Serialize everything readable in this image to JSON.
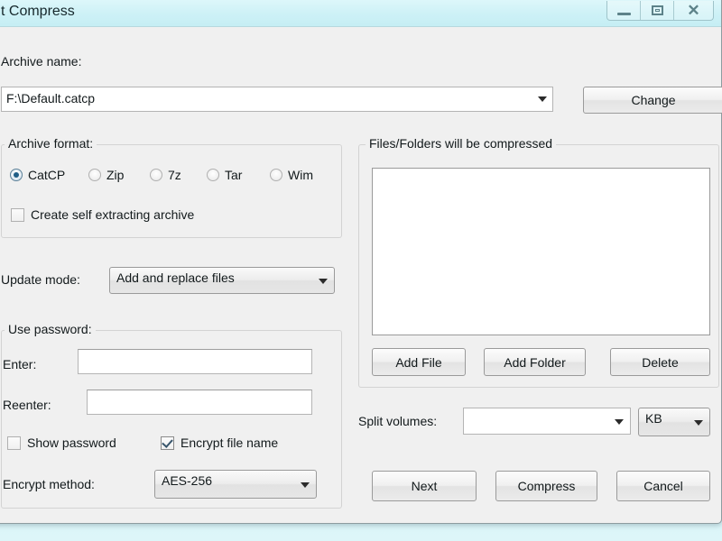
{
  "window": {
    "title": "t Compress",
    "controls": {
      "minimize": "minimize",
      "maximize": "maximize",
      "close": "close"
    }
  },
  "background": {
    "menu_items": [
      "",
      "",
      "",
      "",
      ""
    ]
  },
  "archive_name": {
    "label": "Archive name:",
    "value": "F:\\Default.catcp",
    "change_button": "Change"
  },
  "archive_format": {
    "title": "Archive format:",
    "options": [
      {
        "label": "CatCP",
        "selected": true
      },
      {
        "label": "Zip",
        "selected": false
      },
      {
        "label": "7z",
        "selected": false
      },
      {
        "label": "Tar",
        "selected": false
      },
      {
        "label": "Wim",
        "selected": false
      }
    ],
    "self_extracting": {
      "label": "Create self extracting archive",
      "checked": false
    }
  },
  "update_mode": {
    "label": "Update mode:",
    "value": "Add and replace files"
  },
  "use_password": {
    "title": "Use password:",
    "enter": {
      "label": "Enter:",
      "value": ""
    },
    "reenter": {
      "label": "Reenter:",
      "value": ""
    },
    "show_password": {
      "label": "Show password",
      "checked": false
    },
    "encrypt_file_name": {
      "label": "Encrypt file name",
      "checked": true
    },
    "encrypt_method": {
      "label": "Encrypt method:",
      "value": "AES-256"
    }
  },
  "files_panel": {
    "title": "Files/Folders will be compressed",
    "items": [],
    "add_file": "Add File",
    "add_folder": "Add Folder",
    "delete": "Delete"
  },
  "split_volumes": {
    "label": "Split volumes:",
    "value": "",
    "unit": "KB"
  },
  "actions": {
    "next": "Next",
    "compress": "Compress",
    "cancel": "Cancel"
  },
  "colors": {
    "titlebar": "#cdf1f6",
    "dialog": "#f0f0f0",
    "desktop": "#d6f4f8",
    "radio_accent": "#1f5d86",
    "check_accent": "#37556b"
  }
}
